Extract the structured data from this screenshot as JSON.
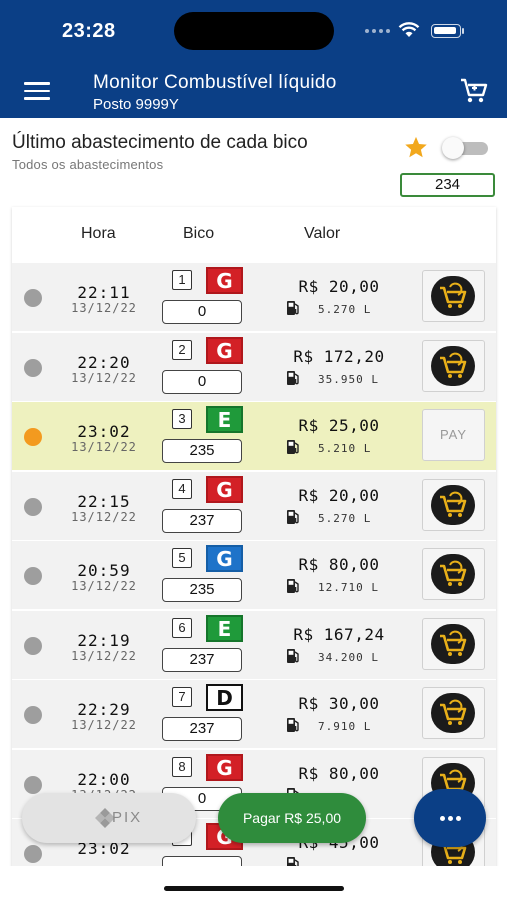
{
  "status_bar": {
    "time": "23:28"
  },
  "header": {
    "title": "Monitor Combustível líquido",
    "subtitle": "Posto 9999Y"
  },
  "section": {
    "title": "Último abastecimento de cada bico",
    "subtitle": "Todos os abastecimentos",
    "count": "234",
    "favorite_color": "#f2a81d"
  },
  "table": {
    "headers": {
      "hora": "Hora",
      "bico": "Bico",
      "valor": "Valor"
    },
    "rows": [
      {
        "time": "22:11",
        "date": "13/12/22",
        "bico": "1",
        "fuel": "G",
        "fuel_type": "gasolina",
        "enc": "0",
        "valor": "R$ 20,00",
        "litros": "5.270 L",
        "status": "idle",
        "action": "cart"
      },
      {
        "time": "22:20",
        "date": "13/12/22",
        "bico": "2",
        "fuel": "G",
        "fuel_type": "gasolina",
        "enc": "0",
        "valor": "R$ 172,20",
        "litros": "35.950 L",
        "status": "idle",
        "action": "cart"
      },
      {
        "time": "23:02",
        "date": "13/12/22",
        "bico": "3",
        "fuel": "E",
        "fuel_type": "etanol",
        "enc": "235",
        "valor": "R$ 25,00",
        "litros": "5.210 L",
        "status": "active",
        "action": "PAY"
      },
      {
        "time": "22:15",
        "date": "13/12/22",
        "bico": "4",
        "fuel": "G",
        "fuel_type": "gasolina",
        "enc": "237",
        "valor": "R$ 20,00",
        "litros": "5.270 L",
        "status": "idle",
        "action": "cart"
      },
      {
        "time": "20:59",
        "date": "13/12/22",
        "bico": "5",
        "fuel": "G",
        "fuel_type": "gasolina-aditivada",
        "enc": "235",
        "valor": "R$ 80,00",
        "litros": "12.710 L",
        "status": "idle",
        "action": "cart"
      },
      {
        "time": "22:19",
        "date": "13/12/22",
        "bico": "6",
        "fuel": "E",
        "fuel_type": "etanol",
        "enc": "237",
        "valor": "R$ 167,24",
        "litros": "34.200 L",
        "status": "idle",
        "action": "cart"
      },
      {
        "time": "22:29",
        "date": "13/12/22",
        "bico": "7",
        "fuel": "D",
        "fuel_type": "diesel",
        "enc": "237",
        "valor": "R$ 30,00",
        "litros": "7.910 L",
        "status": "idle",
        "action": "cart"
      },
      {
        "time": "22:00",
        "date": "13/12/22",
        "bico": "8",
        "fuel": "G",
        "fuel_type": "gasolina",
        "enc": "0",
        "valor": "R$ 80,00",
        "litros": "",
        "status": "idle",
        "action": "cart"
      },
      {
        "time": "23:02",
        "date": "",
        "bico": "9",
        "fuel": "G",
        "fuel_type": "gasolina",
        "enc": "",
        "valor": "R$ 45,00",
        "litros": "",
        "status": "idle",
        "action": "cart"
      }
    ]
  },
  "actions": {
    "pix_label": "PIX",
    "pay_label": "Pagar R$ 25,00",
    "pay_color": "#2f8c3c"
  },
  "icons": [
    "menu-icon",
    "cart-icon",
    "star-icon",
    "fuel-pump-icon",
    "pix-icon",
    "more-icon"
  ],
  "colors": {
    "primary": "#0b3f86",
    "active_row": "#eef1bf",
    "active_dot": "#f39a1f"
  }
}
